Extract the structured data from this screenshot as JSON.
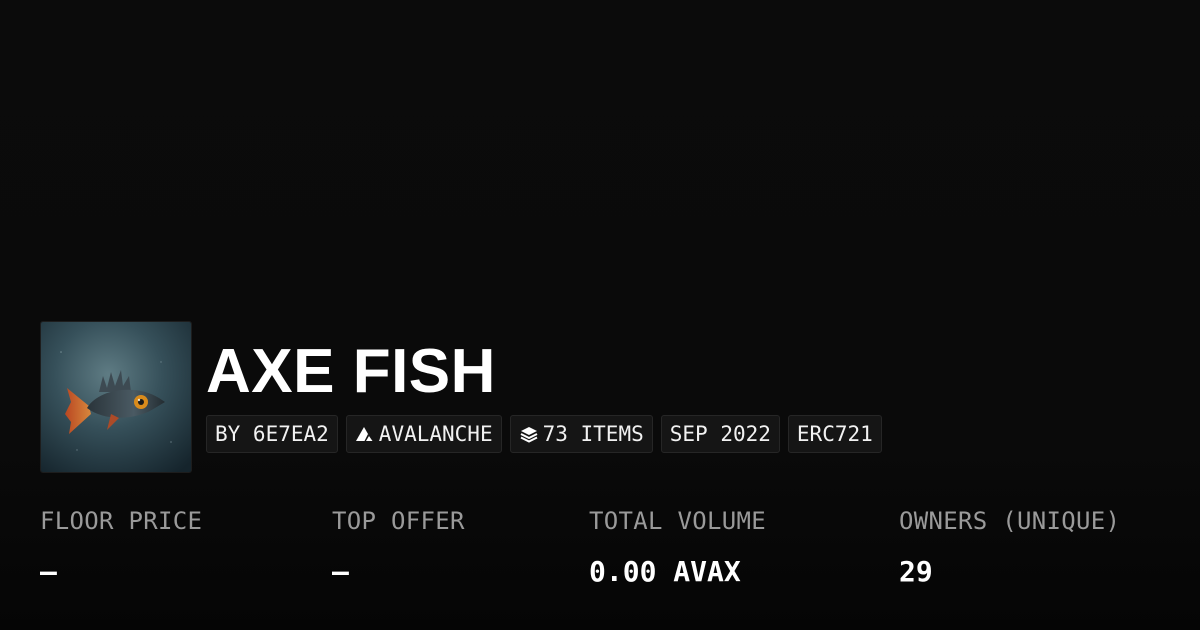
{
  "collection": {
    "title": "AXE FISH",
    "thumbnail_icon": "fish-artwork-image"
  },
  "tags": {
    "creator": "BY 6E7EA2",
    "chain": "AVALANCHE",
    "chain_icon": "avalanche-icon",
    "items": "73 ITEMS",
    "items_icon": "layers-icon",
    "date": "SEP 2022",
    "standard": "ERC721"
  },
  "stats": {
    "floor_price": {
      "label": "FLOOR PRICE",
      "value": "–"
    },
    "top_offer": {
      "label": "TOP OFFER",
      "value": "–"
    },
    "total_volume": {
      "label": "TOTAL VOLUME",
      "value": "0.00 AVAX"
    },
    "owners": {
      "label": "OWNERS (UNIQUE)",
      "value": "29"
    }
  },
  "colors": {
    "background": "#0b0b0b",
    "tag_background": "#151515",
    "label_text": "#9a9a9a",
    "value_text": "#ffffff"
  }
}
